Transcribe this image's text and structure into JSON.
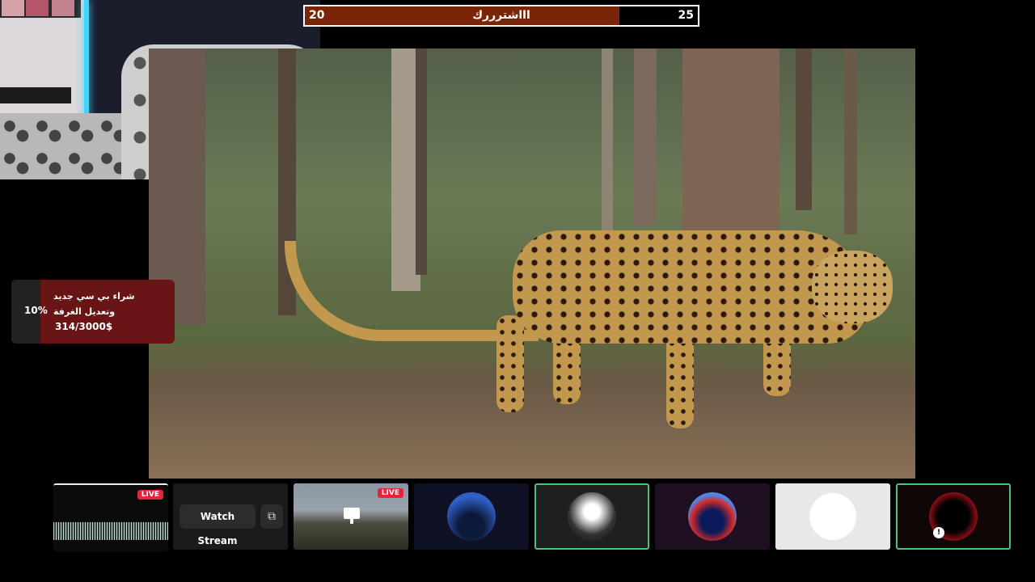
{
  "goal_bar": {
    "left_value": "20",
    "right_value": "25",
    "title": "اااشترررك",
    "progress_fraction": 0.8
  },
  "donation_goal": {
    "percent": "10%",
    "title": "شراء بي سي جديد وتعديل الغرفة",
    "amount": "314/3000$",
    "progress_fraction": 0.1
  },
  "tiles": {
    "live_label": "LIVE",
    "watch_stream_label": "Watch Stream",
    "watch_icon": "picture-in-picture-icon"
  },
  "colors": {
    "goal_fill": "#7a2606",
    "donation_bg": "#6a1515",
    "live_badge": "#e5243b",
    "selected_border": "#4fbf7a"
  }
}
